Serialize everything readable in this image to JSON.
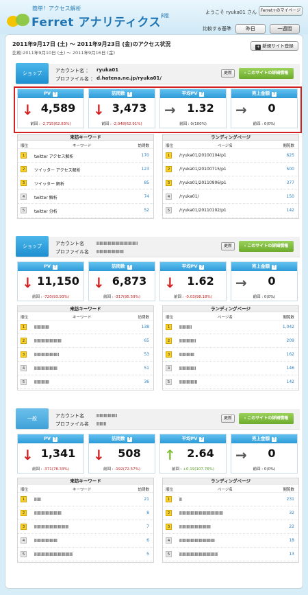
{
  "header": {
    "tagline": "簡単！アクセス解析",
    "brand": "Ferret",
    "brand_suffix": "アナリティクス",
    "edition": "β版",
    "welcome": "ようこそ ryuka01 さん",
    "mypage_label": "Ferret+のマイページ",
    "compare_label": "比較する基準",
    "compare_tabs": [
      "昨日",
      "一週間"
    ]
  },
  "period": {
    "title": "2011年9月17日 (土) ～ 2011年9月23日 (金)のアクセス状況",
    "compare": "比較:2011年9月10日 (土) ～ 2011年9月16日 (金)",
    "new_site_label": "新規サイト登録"
  },
  "sites": [
    {
      "type": "ショップ",
      "account_label": "アカウント名 ：",
      "account": "ryuka01",
      "profile_label": "プロファイル名 ：",
      "profile": "d.hatena.ne.jp/ryuka01/",
      "update_label": "更新",
      "detail_label": "このサイトの詳細情報",
      "metrics": [
        {
          "name": "PV",
          "value": "4,589",
          "trend": "down",
          "prev_label": "前回 : ",
          "delta": "-2,715(62.83%)"
        },
        {
          "name": "訪問数",
          "value": "3,473",
          "trend": "down",
          "prev_label": "前回 : ",
          "delta": "-2,048(62.91%)"
        },
        {
          "name": "平均PV",
          "value": "1.32",
          "trend": "flat",
          "prev_label": "前回 : ",
          "delta": "0(100%)"
        },
        {
          "name": "売上金額",
          "value": "0",
          "trend": "flat",
          "prev_label": "前回 : ",
          "delta": "0(0%)"
        }
      ],
      "keywords": {
        "title": "来訪キーワード",
        "cols": [
          "順位",
          "キーワード",
          "訪問数"
        ],
        "rows": [
          {
            "rank": "1",
            "text": "twitter アクセス解析",
            "count": "170"
          },
          {
            "rank": "2",
            "text": "ツイッター アクセス解析",
            "count": "123"
          },
          {
            "rank": "3",
            "text": "ツイッター 解析",
            "count": "85"
          },
          {
            "rank": "4",
            "text": "twitter 解析",
            "count": "74"
          },
          {
            "rank": "5",
            "text": "twitter 分析",
            "count": "52"
          }
        ]
      },
      "landing": {
        "title": "ランディングページ",
        "cols": [
          "順位",
          "ページ名",
          "閲覧数"
        ],
        "rows": [
          {
            "rank": "1",
            "text": "/ryuka01/20100104/p1",
            "count": "625"
          },
          {
            "rank": "2",
            "text": "/ryuka01/20100715/p1",
            "count": "500"
          },
          {
            "rank": "3",
            "text": "/ryuka01/20110906/p1",
            "count": "377"
          },
          {
            "rank": "4",
            "text": "/ryuka01/",
            "count": "150"
          },
          {
            "rank": "5",
            "text": "/ryuka01/20110102/p1",
            "count": "142"
          }
        ]
      }
    },
    {
      "type": "ショップ",
      "account_label": "アカウント名",
      "profile_label": "プロファイル名",
      "update_label": "更新",
      "detail_label": "このサイトの詳細情報",
      "metrics": [
        {
          "name": "PV",
          "value": "11,150",
          "trend": "down",
          "prev_label": "前回 : ",
          "delta": "-720(93.93%)"
        },
        {
          "name": "訪問数",
          "value": "6,873",
          "trend": "down",
          "prev_label": "前回 : ",
          "delta": "-317(95.59%)"
        },
        {
          "name": "平均PV",
          "value": "1.62",
          "trend": "down",
          "prev_label": "前回 : ",
          "delta": "-0.03(98.18%)"
        },
        {
          "name": "売上金額",
          "value": "0",
          "trend": "flat",
          "prev_label": "前回 : ",
          "delta": "0(0%)"
        }
      ],
      "keywords": {
        "title": "来訪キーワード",
        "cols": [
          "順位",
          "キーワード",
          "訪問数"
        ],
        "rows": [
          {
            "rank": "1",
            "count": "138"
          },
          {
            "rank": "2",
            "count": "65"
          },
          {
            "rank": "3",
            "count": "53"
          },
          {
            "rank": "4",
            "count": "51"
          },
          {
            "rank": "5",
            "count": "36"
          }
        ]
      },
      "landing": {
        "title": "ランディングページ",
        "cols": [
          "順位",
          "ページ名",
          "閲覧数"
        ],
        "rows": [
          {
            "rank": "1",
            "count": "1,042"
          },
          {
            "rank": "2",
            "count": "209"
          },
          {
            "rank": "3",
            "count": "162"
          },
          {
            "rank": "4",
            "count": "146"
          },
          {
            "rank": "5",
            "count": "142"
          }
        ]
      }
    },
    {
      "type": "一般",
      "account_label": "アカウント名",
      "profile_label": "プロファイル名",
      "update_label": "更新",
      "detail_label": "このサイトの詳細情報",
      "metrics": [
        {
          "name": "PV",
          "value": "1,341",
          "trend": "down",
          "prev_label": "前回 : ",
          "delta": "-371(78.33%)"
        },
        {
          "name": "訪問数",
          "value": "508",
          "trend": "down",
          "prev_label": "前回 : ",
          "delta": "-192(72.57%)"
        },
        {
          "name": "平均PV",
          "value": "2.64",
          "trend": "up",
          "prev_label": "前回 : ",
          "delta": "+0.19(107.76%)"
        },
        {
          "name": "売上金額",
          "value": "0",
          "trend": "flat",
          "prev_label": "前回 : ",
          "delta": "0(0%)"
        }
      ],
      "keywords": {
        "title": "来訪キーワード",
        "cols": [
          "順位",
          "キーワード",
          "訪問数"
        ],
        "rows": [
          {
            "rank": "1",
            "count": "21"
          },
          {
            "rank": "2",
            "count": "8"
          },
          {
            "rank": "3",
            "count": "7"
          },
          {
            "rank": "4",
            "count": "6"
          },
          {
            "rank": "5",
            "count": "5"
          }
        ]
      },
      "landing": {
        "title": "ランディングページ",
        "cols": [
          "順位",
          "ページ名",
          "閲覧数"
        ],
        "rows": [
          {
            "rank": "1",
            "count": "231"
          },
          {
            "rank": "2",
            "count": "32"
          },
          {
            "rank": "3",
            "count": "22"
          },
          {
            "rank": "4",
            "count": "18"
          },
          {
            "rank": "5",
            "count": "13"
          }
        ]
      }
    }
  ]
}
